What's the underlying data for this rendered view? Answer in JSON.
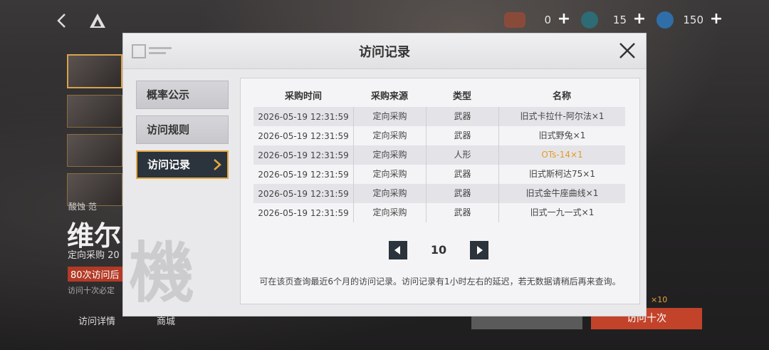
{
  "top_bar": {
    "resources": [
      {
        "icon": "ticket-icon",
        "value": "0",
        "color": "#8a4a3a"
      },
      {
        "icon": "crystal-icon",
        "value": "15",
        "color": "#2d6b75"
      },
      {
        "icon": "coin-icon",
        "value": "150",
        "color": "#2f6ea8"
      }
    ]
  },
  "background": {
    "tag_line": "酸蚀  范",
    "name": "维尔",
    "sub": "定向采购 20",
    "badge": "80次访问后",
    "note": "访问十次必定",
    "links": [
      "访问详情",
      "商城"
    ],
    "btn_ten": "访问十次",
    "ten_tag": "×10"
  },
  "modal": {
    "title": "访问记录",
    "tabs": [
      {
        "label": "概率公示",
        "active": false
      },
      {
        "label": "访问规则",
        "active": false
      },
      {
        "label": "访问记录",
        "active": true
      }
    ],
    "watermark": "機",
    "columns": [
      "采购时间",
      "采购来源",
      "类型",
      "名称"
    ],
    "rows": [
      {
        "time": "2026-05-19 12:31:59",
        "source": "定向采购",
        "type": "武器",
        "name": "旧式卡拉什-阿尔法×1",
        "highlight": false
      },
      {
        "time": "2026-05-19 12:31:59",
        "source": "定向采购",
        "type": "武器",
        "name": "旧式野兔×1",
        "highlight": false
      },
      {
        "time": "2026-05-19 12:31:59",
        "source": "定向采购",
        "type": "人形",
        "name": "OTs-14×1",
        "highlight": true
      },
      {
        "time": "2026-05-19 12:31:59",
        "source": "定向采购",
        "type": "武器",
        "name": "旧式斯柯达75×1",
        "highlight": false
      },
      {
        "time": "2026-05-19 12:31:59",
        "source": "定向采购",
        "type": "武器",
        "name": "旧式金牛座曲线×1",
        "highlight": false
      },
      {
        "time": "2026-05-19 12:31:59",
        "source": "定向采购",
        "type": "武器",
        "name": "旧式一九一式×1",
        "highlight": false
      }
    ],
    "page": "10",
    "footnote": "可在该页查询最近6个月的访问记录。访问记录有1小时左右的延迟，若无数据请稍后再来查询。",
    "colors": {
      "active_border": "#e2a93e",
      "highlight": "#e59a2a",
      "dark": "#2b333c"
    }
  }
}
